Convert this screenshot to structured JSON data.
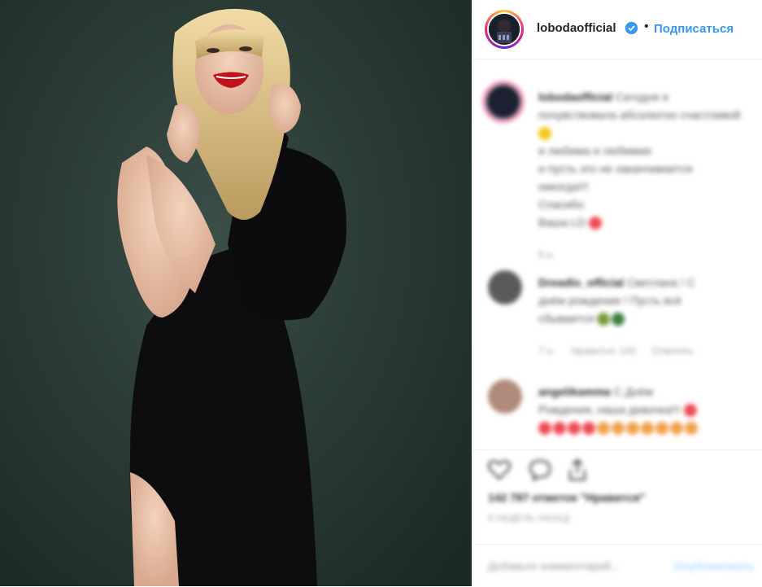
{
  "post": {
    "author": "lobodaofficial",
    "follow_label": "Подписаться",
    "separator": "•"
  },
  "comments": [
    {
      "author": "lobodaofficial",
      "lines": [
        "Сегодня я",
        "почувствовала абсолютно счастливой",
        "и любима и любимая",
        "и пусть это не заканчивается",
        "никогда!!!",
        "Спасибо",
        "Ваша LD"
      ],
      "meta": "9 н."
    },
    {
      "author": "Dreadlo_official",
      "lines": [
        "Светлана ! С",
        "днём рождения ! Пусть всё",
        "сбывается"
      ],
      "meta": [
        "7 н.",
        "Нравится: 140",
        "Ответить"
      ]
    },
    {
      "author": "angelikamma",
      "lines": [
        "С Днём",
        "Рождения, наша девочка!!!"
      ],
      "meta": ""
    }
  ],
  "actions": {
    "likes": "142 787 отметок \"Нравится\"",
    "date": "9 НЕДЕЛЬ НАЗАД"
  },
  "composer": {
    "placeholder": "Добавьте комментарий...",
    "publish_label": "Опубликовать"
  },
  "colors": {
    "accent": "#3897f0",
    "verified": "#3897f0",
    "heart": "#ed4956",
    "text": "#262626"
  }
}
